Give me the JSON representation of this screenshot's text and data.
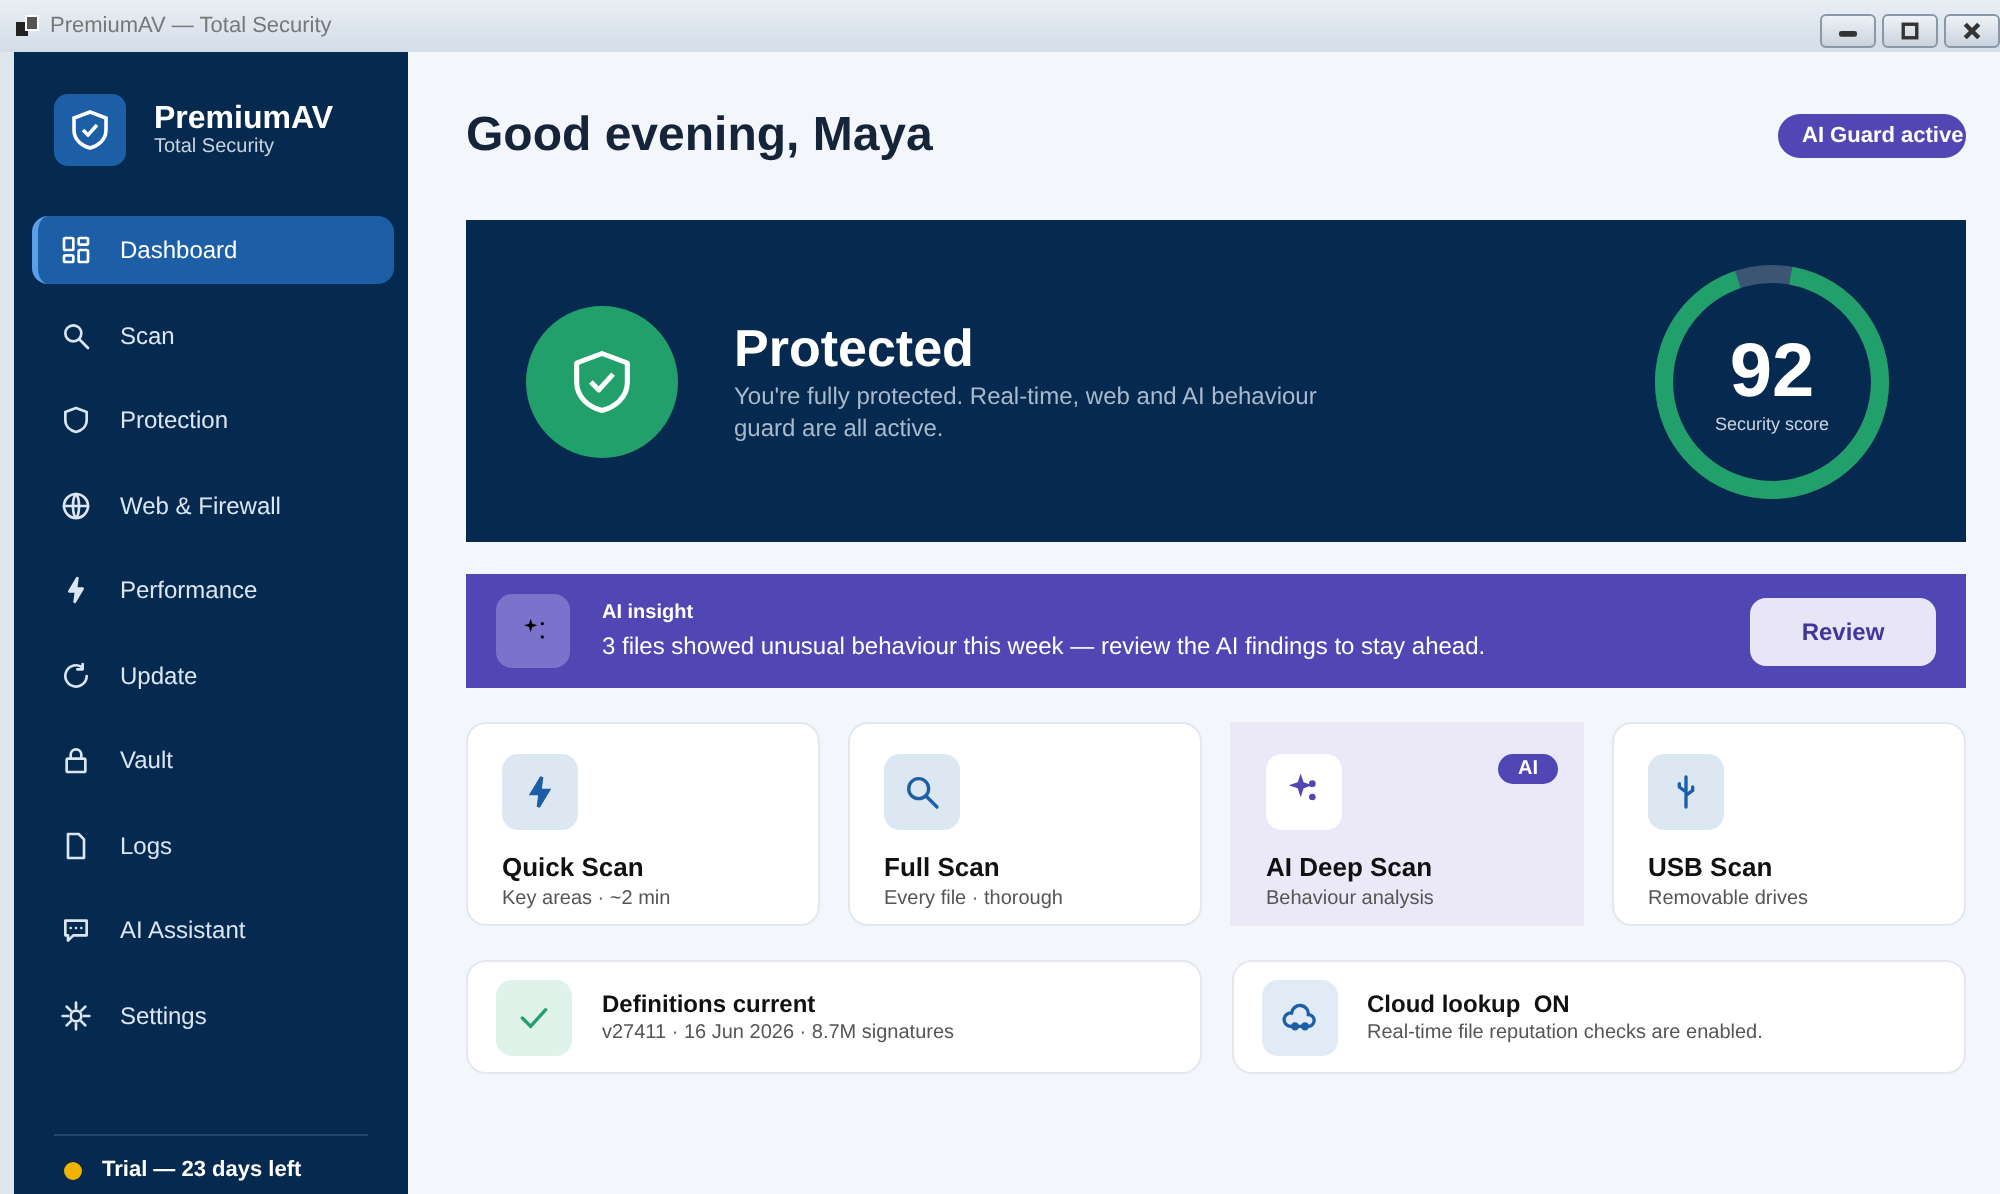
{
  "window": {
    "title": "PremiumAV — Total Security"
  },
  "brand": {
    "name": "PremiumAV",
    "subtitle": "Total Security"
  },
  "sidebar": {
    "items": [
      {
        "label": "Dashboard",
        "selected": true
      },
      {
        "label": "Scan",
        "selected": false
      },
      {
        "label": "Protection",
        "selected": false
      },
      {
        "label": "Web & Firewall",
        "selected": false
      },
      {
        "label": "Performance",
        "selected": false
      },
      {
        "label": "Update",
        "selected": false
      },
      {
        "label": "Vault",
        "selected": false
      },
      {
        "label": "Logs",
        "selected": false
      },
      {
        "label": "AI Assistant",
        "selected": false
      },
      {
        "label": "Settings",
        "selected": false
      }
    ],
    "trial": {
      "label": "Trial — 23 days left",
      "color": "#f0b400"
    }
  },
  "header": {
    "greeting": "Good evening, Maya",
    "badge": "AI Guard active"
  },
  "hero": {
    "status": "Protected",
    "description": "You're fully protected. Real-time, web and AI behaviour guard are all active.",
    "score": "92",
    "score_label": "Security score",
    "level": 0.92
  },
  "insight": {
    "title": "AI insight",
    "message": "3 files showed unusual behaviour this week — review the AI findings to stay ahead.",
    "button": "Review"
  },
  "scans": [
    {
      "title": "Quick Scan",
      "subtitle": "Key areas · ~2 min",
      "selected": false
    },
    {
      "title": "Full Scan",
      "subtitle": "Every file · thorough",
      "selected": false
    },
    {
      "title": "AI Deep Scan",
      "subtitle": "Behaviour analysis",
      "selected": true,
      "badge": "AI"
    },
    {
      "title": "USB Scan",
      "subtitle": "Removable drives",
      "selected": false
    }
  ],
  "status_cards": [
    {
      "title": "Definitions current",
      "detail": "v27411 · 16 Jun 2026 · 8.7M signatures"
    },
    {
      "title": "Cloud lookup  ON",
      "detail": "Real-time file reputation checks are enabled."
    }
  ]
}
